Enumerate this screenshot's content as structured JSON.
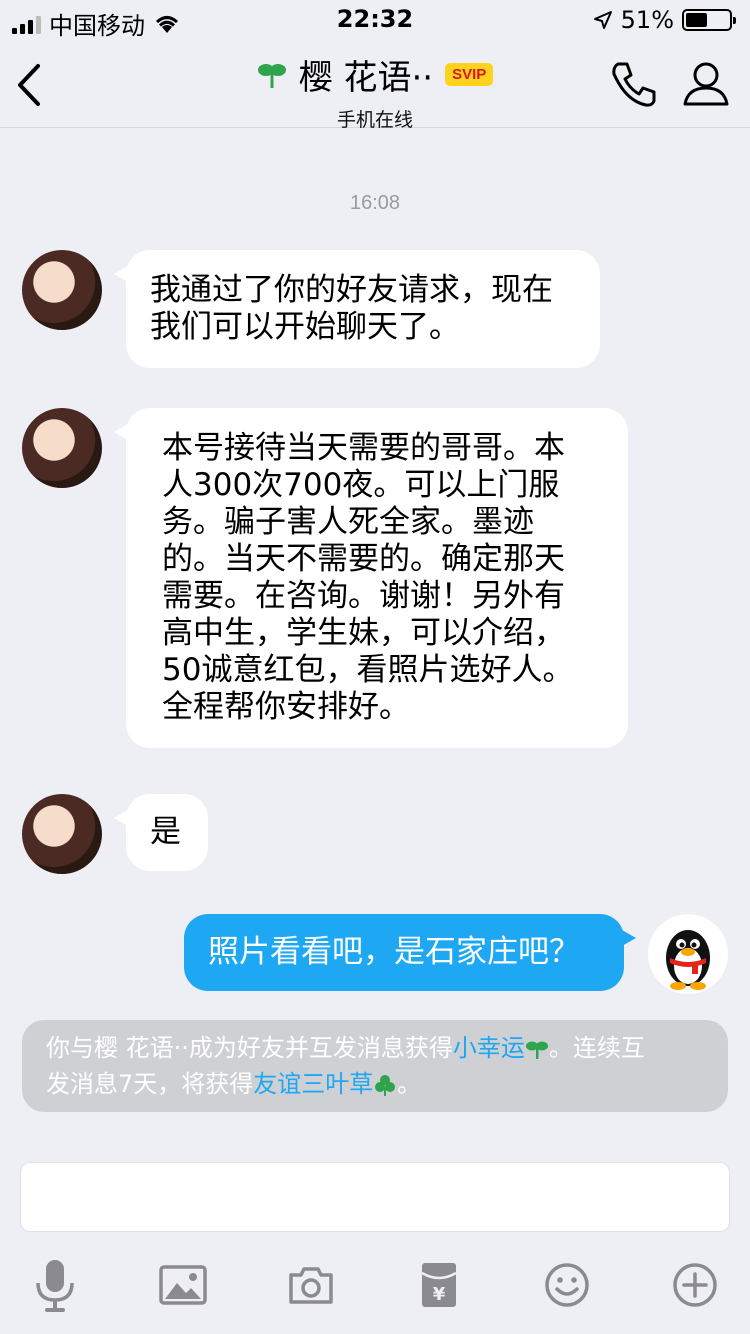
{
  "status_bar": {
    "carrier": "中国移动",
    "time": "22:32",
    "battery": "51%",
    "battery_level": 0.51,
    "icons": [
      "signal-icon",
      "wifi-icon",
      "location-icon",
      "battery-icon"
    ]
  },
  "header": {
    "title": "樱 花语··",
    "badge": "SVIP",
    "subtitle": "手机在线",
    "icons": [
      "back-icon",
      "sprout-icon",
      "phone-icon",
      "person-icon"
    ],
    "accent_color": "#2ea44f"
  },
  "chat": {
    "timestamp": "16:08",
    "messages": [
      {
        "side": "in",
        "lines": [
          "我通过了你的好友请求，现在",
          "我们可以开始聊天了。"
        ]
      },
      {
        "side": "in",
        "lines": [
          "本号接待当天需要的哥哥。本",
          "人300次700夜。可以上门服",
          "务。骗子害人死全家。墨迹",
          "的。当天不需要的。确定那天",
          "需要。在咨询。谢谢！另外有",
          "高中生，学生妹，可以介绍，",
          "50诚意红包，看照片选好人。",
          "全程帮你安排好。"
        ]
      },
      {
        "side": "in",
        "lines": [
          "是"
        ]
      },
      {
        "side": "out",
        "lines": [
          "照片看看吧，是石家庄吧？"
        ]
      }
    ],
    "outgoing_bubble_color": "#1ea7f2"
  },
  "system_message": {
    "part1": "你与樱 花语··成为好友并互发消息获得",
    "link1": "小幸运",
    "part2": "。连续互",
    "part3": "发消息7天，将获得",
    "link2": "友谊三叶草",
    "part4": "。"
  },
  "input": {
    "value": ""
  },
  "toolbar": {
    "icons": [
      "microphone-icon",
      "image-icon",
      "camera-icon",
      "red-packet-icon",
      "emoji-icon",
      "plus-icon"
    ]
  }
}
